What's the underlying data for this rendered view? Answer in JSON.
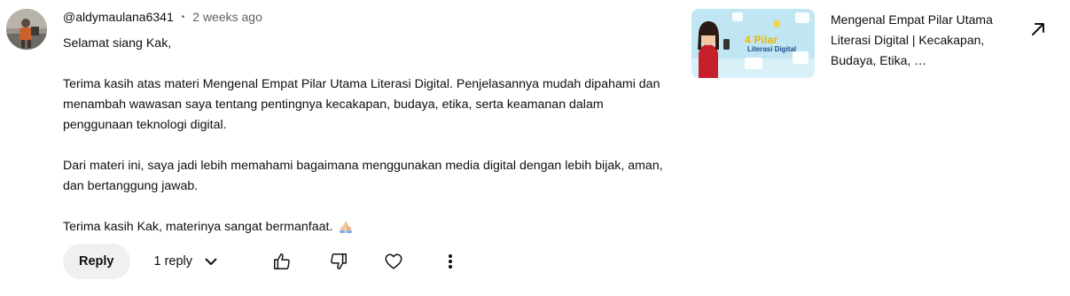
{
  "comment": {
    "author": "@aldymaulana6341",
    "separator": "•",
    "time": "2 weeks ago",
    "paragraphs": [
      "Selamat siang Kak,",
      "Terima kasih atas materi Mengenal Empat Pilar Utama Literasi Digital. Penjelasannya mudah dipahami dan menambah wawasan saya tentang pentingnya kecakapan, budaya, etika, serta keamanan dalam penggunaan teknologi digital.",
      "Dari materi ini, saya jadi lebih memahami bagaimana menggunakan media digital dengan lebih bijak, aman, dan bertanggung jawab.",
      "Terima kasih Kak, materinya sangat bermanfaat."
    ],
    "emoji_icon": "folded-hands-emoji"
  },
  "actions": {
    "reply_label": "Reply",
    "replies_label": "1 reply",
    "icons": [
      "chevron-down-icon",
      "thumbs-up-icon",
      "thumbs-down-icon",
      "heart-icon",
      "more-vertical-icon"
    ]
  },
  "video": {
    "title": "Mengenal Empat Pilar Utama Literasi Digital | Kecakapan, Budaya, Etika, …",
    "thumbnail_text_line1": "4 Pilar",
    "thumbnail_text_line2": "Literasi Digital",
    "open_icon": "arrow-up-right-icon"
  },
  "colors": {
    "text": "#0f0f0f",
    "secondary_text": "#606060",
    "button_bg": "#f0f0f0",
    "thumbnail_bg": "#bfe6f2",
    "thumbnail_accent": "#f2b400"
  }
}
